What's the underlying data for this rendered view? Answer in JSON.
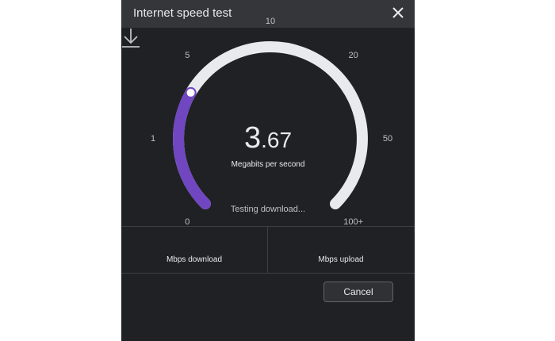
{
  "dialog": {
    "title": "Internet speed test",
    "close_icon": "close-icon"
  },
  "gauge": {
    "ticks": [
      "0",
      "1",
      "5",
      "10",
      "20",
      "50",
      "100+"
    ],
    "speed_integer": "3",
    "speed_decimal": ".67",
    "speed_value": 3.67,
    "unit": "Megabits per second",
    "status": "Testing download...",
    "status_icon": "download-arrow-icon",
    "colors": {
      "track": "#e8eaed",
      "progress": "#7046c1",
      "background": "#202124"
    }
  },
  "results": {
    "download_label": "Mbps download",
    "upload_label": "Mbps upload"
  },
  "buttons": {
    "cancel_label": "Cancel"
  }
}
